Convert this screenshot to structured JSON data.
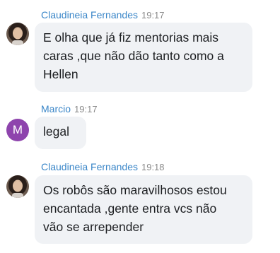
{
  "messages": [
    {
      "sender": "Claudineia Fernandes",
      "time": "19:17",
      "avatar": "photo-avatar",
      "text": "E olha que já fiz mentorias mais\ncaras ,que não dão tanto como a\nHellen"
    },
    {
      "sender": "Marcio",
      "time": "19:17",
      "avatar_initial": "M",
      "avatar_color": "#8e44ad",
      "text": "legal"
    },
    {
      "sender": "Claudineia Fernandes",
      "time": "19:18",
      "avatar": "photo-avatar",
      "text": "Os robôs são maravilhosos estou\nencantada ,gente entra vcs não\nvão se arrepender"
    }
  ],
  "colors": {
    "sender_name": "#3a86c8",
    "timestamp": "#8a8a8a",
    "bubble_background": "#f0f2f5",
    "message_text": "#1c1e21"
  }
}
